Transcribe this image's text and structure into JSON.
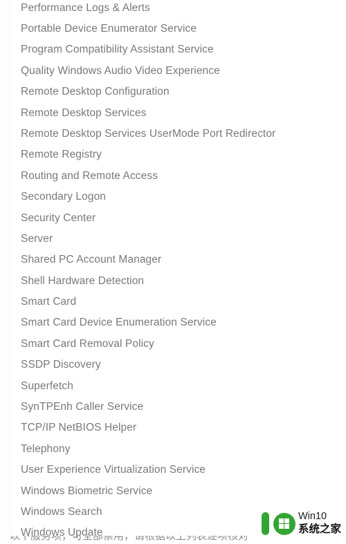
{
  "window": {
    "background_color": "#ffffff",
    "text_color": "#77797b"
  },
  "services_list": {
    "name": "windows-services-name-list",
    "items": [
      "Performance Logs & Alerts",
      "Portable Device Enumerator Service",
      "Program Compatibility Assistant Service",
      "Quality Windows Audio Video Experience",
      "Remote Desktop Configuration",
      "Remote Desktop Services",
      "Remote Desktop Services UserMode Port Redirector",
      "Remote Registry",
      "Routing and Remote Access",
      "Secondary Logon",
      "Security Center",
      "Server",
      "Shared PC Account Manager",
      "Shell Hardware Detection",
      "Smart Card",
      "Smart Card Device Enumeration Service",
      "Smart Card Removal Policy",
      "SSDP Discovery",
      "Superfetch",
      "SynTPEnh Caller Service",
      "TCP/IP NetBIOS Helper",
      "Telephony",
      "User Experience Virtualization Service",
      "Windows Biometric Service",
      "Windows Search",
      "Windows Update"
    ]
  },
  "footer_clipped": {
    "text": "以下服务项，可全部禁用，请根据以上列表逐项核对"
  },
  "watermark": {
    "line1": "Win10",
    "line2": "系统之家",
    "logo_color": "#33a532",
    "text_color": "#1b1b1b",
    "icons": {
      "bar": "letter-i-bar-icon",
      "circle": "letter-o-circle-icon",
      "flag": "windows-flag-icon"
    }
  }
}
